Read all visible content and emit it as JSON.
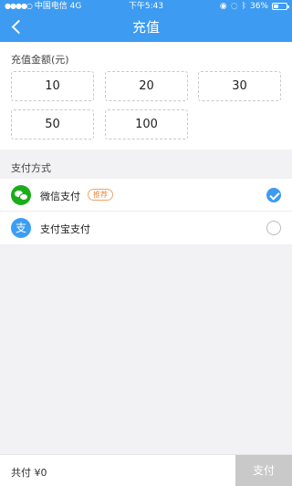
{
  "status_bar": {
    "signal": "●●●●○",
    "carrier": "中国电信",
    "network": "4G",
    "time": "下午5:43",
    "battery": "36%",
    "battery_level": 0.36
  },
  "nav": {
    "title": "充值"
  },
  "amount": {
    "label": "充值金额(元)",
    "options": [
      "10",
      "20",
      "30",
      "50",
      "100"
    ]
  },
  "payment": {
    "label": "支付方式",
    "methods": [
      {
        "name": "微信支付",
        "badge": "推荐",
        "icon": "wechat-icon",
        "checked": true
      },
      {
        "name": "支付宝支付",
        "icon": "alipay-icon",
        "checked": false
      }
    ]
  },
  "footer": {
    "total_prefix": "共付 ¥",
    "total_value": "0",
    "pay_button": "支付"
  },
  "colors": {
    "accent": "#3d9bf1",
    "wechat": "#1aad19",
    "badge": "#f08a3c",
    "disabled": "#c9c9c9"
  }
}
